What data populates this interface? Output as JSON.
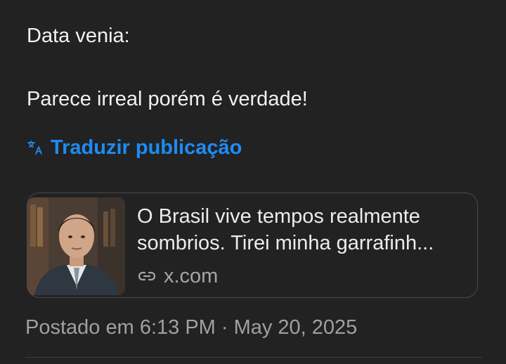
{
  "post": {
    "line1": "Data venia:",
    "line2": "Parece irreal porém é verdade!",
    "translate_label": "Traduzir publicação"
  },
  "link_card": {
    "title_line1": "O Brasil vive tempos realmente",
    "title_line2": "sombrios. Tirei minha garrafinh...",
    "domain": "x.com",
    "thumbnail": "portrait-photo"
  },
  "meta": {
    "posted": "Postado em 6:13 PM · May 20, 2025"
  },
  "colors": {
    "background": "#222223",
    "accent": "#1d8cf2",
    "muted": "#a0a0a3"
  },
  "icons": [
    "translate-icon",
    "link-icon"
  ]
}
